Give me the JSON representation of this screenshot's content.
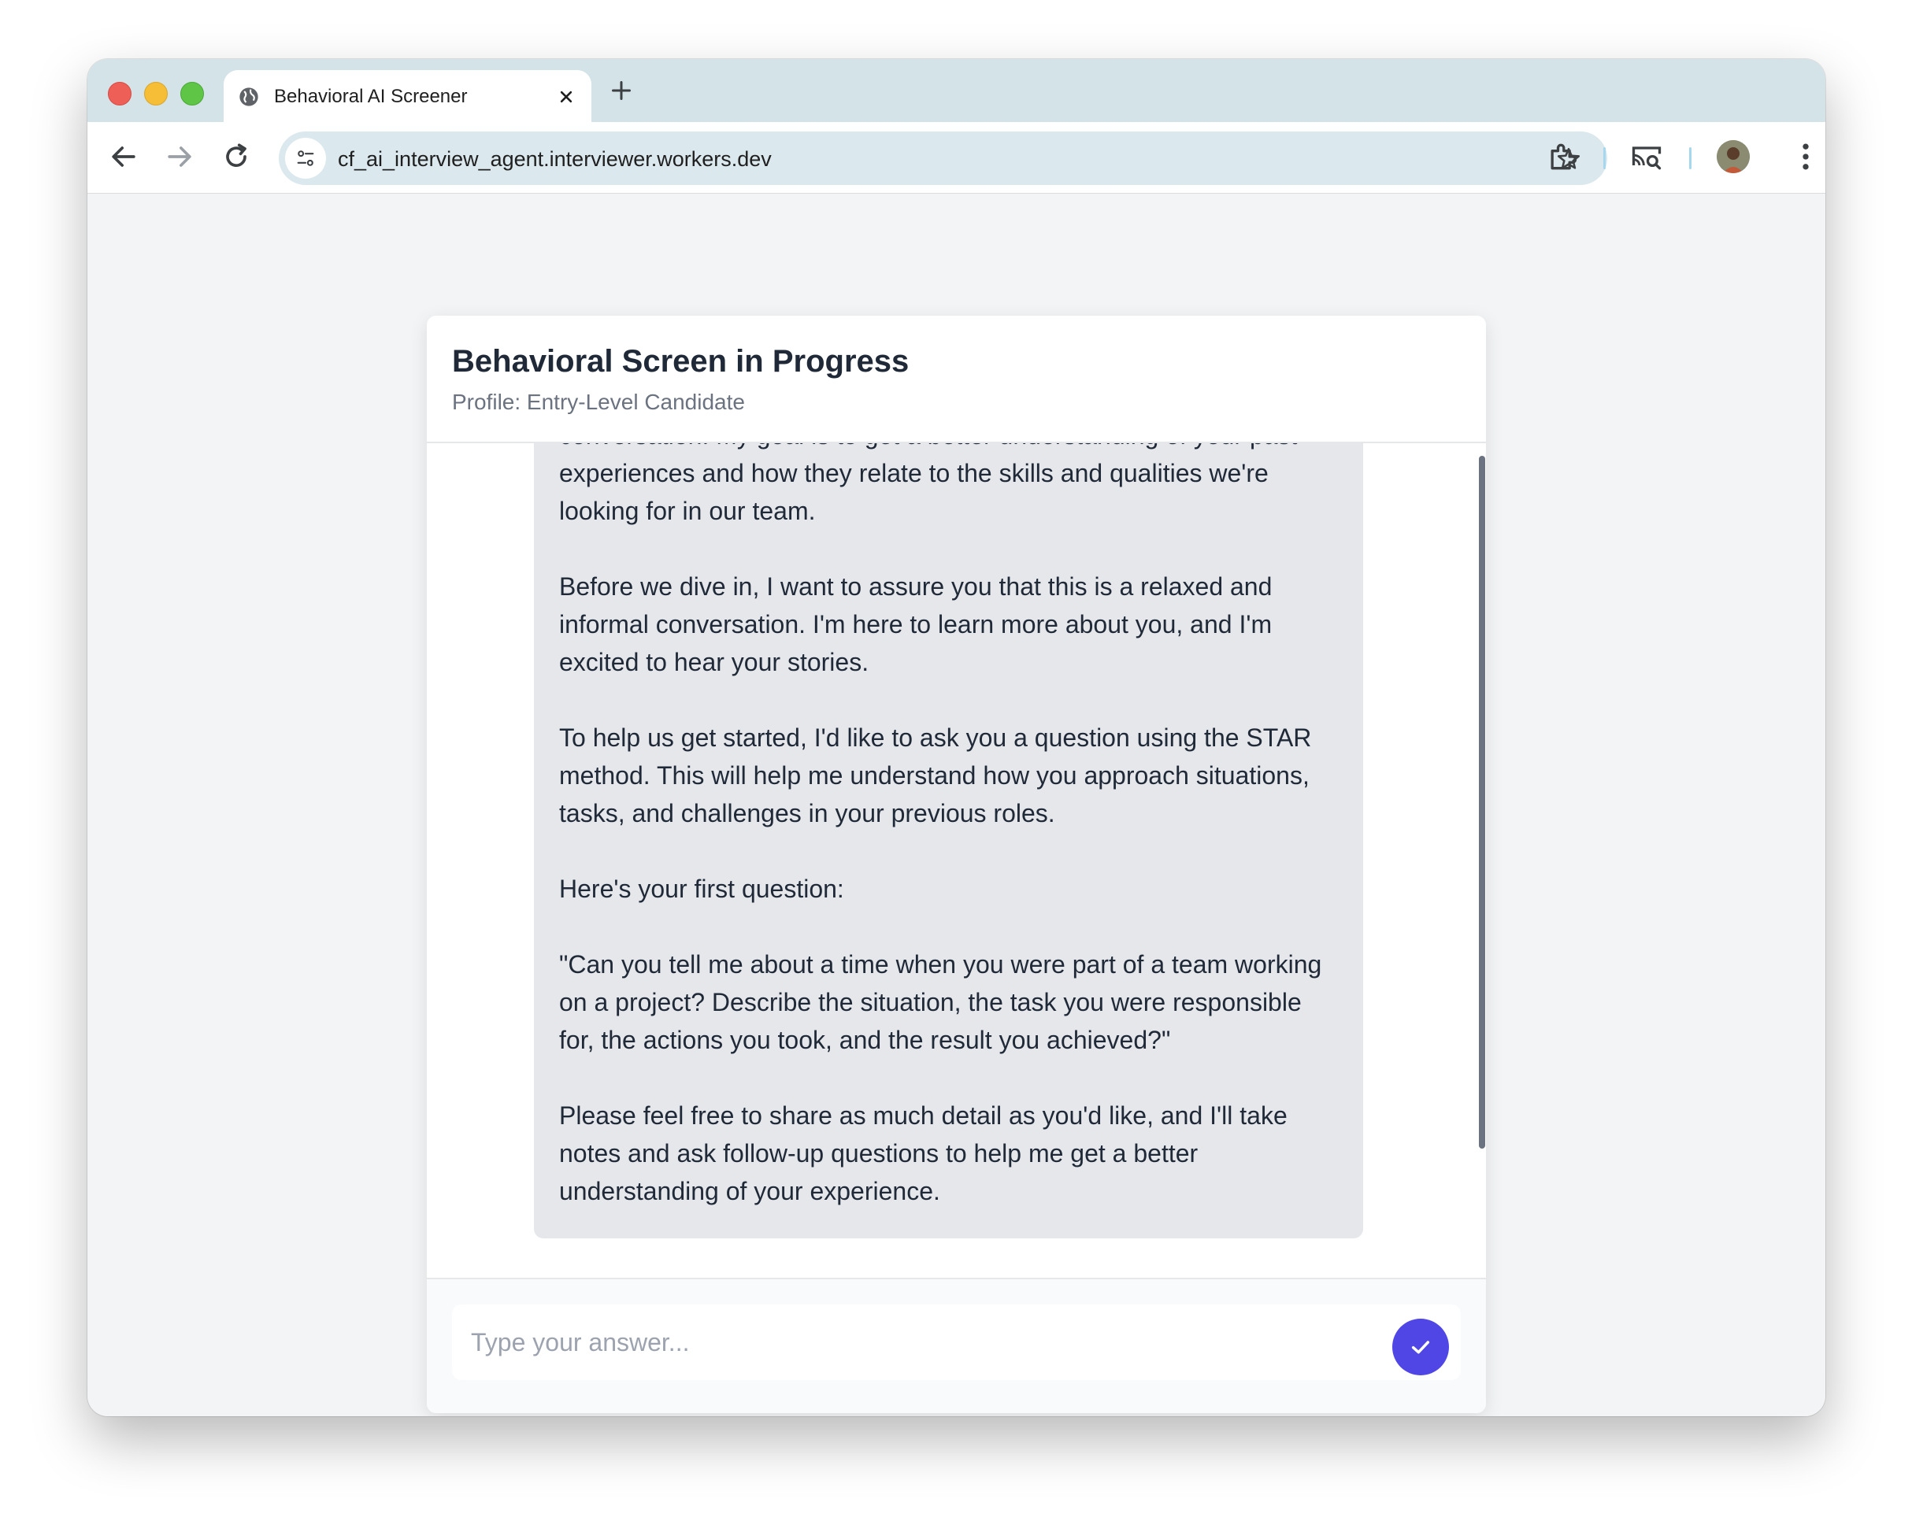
{
  "browser": {
    "tab_title": "Behavioral AI Screener",
    "url": "cf_ai_interview_agent.interviewer.workers.dev",
    "icons": [
      "globe-icon",
      "close-icon",
      "plus-icon",
      "back-arrow-icon",
      "forward-arrow-icon",
      "reload-icon",
      "site-info-icon",
      "star-icon",
      "extensions-icon",
      "cast-search-icon",
      "avatar",
      "more-vert-icon"
    ]
  },
  "header": {
    "title": "Behavioral Screen in Progress",
    "subtitle": "Profile: Entry-Level Candidate"
  },
  "messages": [
    {
      "role": "assistant",
      "paragraphs": [
        "conversation. My goal is to get a better understanding of your past experiences and how they relate to the skills and qualities we're looking for in our team.",
        "Before we dive in, I want to assure you that this is a relaxed and informal conversation. I'm here to learn more about you, and I'm excited to hear your stories.",
        "To help us get started, I'd like to ask you a question using the STAR method. This will help me understand how you approach situations, tasks, and challenges in your previous roles.",
        "Here's your first question:",
        "\"Can you tell me about a time when you were part of a team working on a project? Describe the situation, the task you were responsible for, the actions you took, and the result you achieved?\"",
        "Please feel free to share as much detail as you'd like, and I'll take notes and ask follow-up questions to help me get a better understanding of your experience."
      ]
    }
  ],
  "input": {
    "placeholder": "Type your answer...",
    "value": ""
  },
  "colors": {
    "accent": "#4f46e5",
    "bubble": "#e5e7eb",
    "page_bg": "#f3f4f6"
  }
}
